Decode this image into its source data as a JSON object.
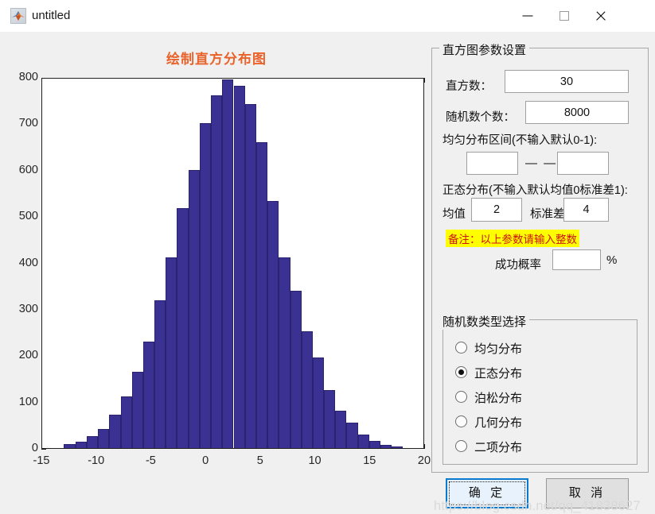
{
  "window": {
    "title": "untitled",
    "icon": "matlab-icon",
    "minimize_label": "",
    "maximize_label": "",
    "close_label": ""
  },
  "figure": {
    "title": "绘制直方分布图",
    "title_color": "#e8622a"
  },
  "chart_data": {
    "type": "bar",
    "title": "绘制直方分布图",
    "xlabel": "",
    "ylabel": "",
    "xlim": [
      -15,
      20
    ],
    "ylim": [
      0,
      800
    ],
    "xticks": [
      "-15",
      "-10",
      "-5",
      "0",
      "5",
      "10",
      "15",
      "20"
    ],
    "yticks": [
      "0",
      "100",
      "200",
      "300",
      "400",
      "500",
      "600",
      "700",
      "800"
    ],
    "grid": false,
    "legend": null,
    "bar_color": "#3a3192",
    "bar_edge_color": "#2a2470",
    "bin_count": 30,
    "bin_edges": [
      -13.0,
      -11.97,
      -10.93,
      -9.9,
      -8.87,
      -7.83,
      -6.8,
      -5.77,
      -4.73,
      -3.7,
      -2.67,
      -1.63,
      -0.6,
      0.43,
      1.47,
      2.5,
      3.53,
      4.57,
      5.6,
      6.63,
      7.67,
      8.7,
      9.73,
      10.77,
      11.8,
      12.83,
      13.87,
      14.9,
      15.93,
      16.97,
      18.0
    ],
    "values": [
      8,
      14,
      26,
      41,
      72,
      112,
      165,
      230,
      318,
      412,
      517,
      600,
      700,
      760,
      795,
      782,
      742,
      660,
      533,
      412,
      340,
      252,
      196,
      125,
      81,
      54,
      30,
      16,
      7,
      4
    ]
  },
  "settings_panel": {
    "title": "直方图参数设置",
    "bins": {
      "label": "直方数：",
      "value": "30",
      "placeholder": ""
    },
    "count": {
      "label": "随机数个数：",
      "value": "8000",
      "placeholder": ""
    },
    "uniform": {
      "label": "均匀分布区间(不输入默认0-1):",
      "separator": "— —",
      "min_value": "",
      "min_placeholder": "",
      "max_value": "",
      "max_placeholder": ""
    },
    "normal": {
      "label": "正态分布(不输入默认均值0标准差1):",
      "mean_label": "均值",
      "mean_value": "2",
      "mean_placeholder": "",
      "std_label": "标准差",
      "std_value": "4",
      "std_placeholder": ""
    },
    "note": "备注：以上参数请输入整数",
    "note_bg": "#ffff00",
    "note_color": "#cc1111",
    "probability": {
      "label": "成功概率",
      "value": "",
      "placeholder": "",
      "unit": "%"
    }
  },
  "distribution_group": {
    "title": "随机数类型选择",
    "options": [
      {
        "label": "均匀分布",
        "selected": false
      },
      {
        "label": "正态分布",
        "selected": true
      },
      {
        "label": "泊松分布",
        "selected": false
      },
      {
        "label": "几何分布",
        "selected": false
      },
      {
        "label": "二项分布",
        "selected": false
      }
    ]
  },
  "actions": {
    "ok_label": "确 定",
    "cancel_label": "取 消"
  },
  "watermark": "https://blog.csdn.net/qq_41838627"
}
